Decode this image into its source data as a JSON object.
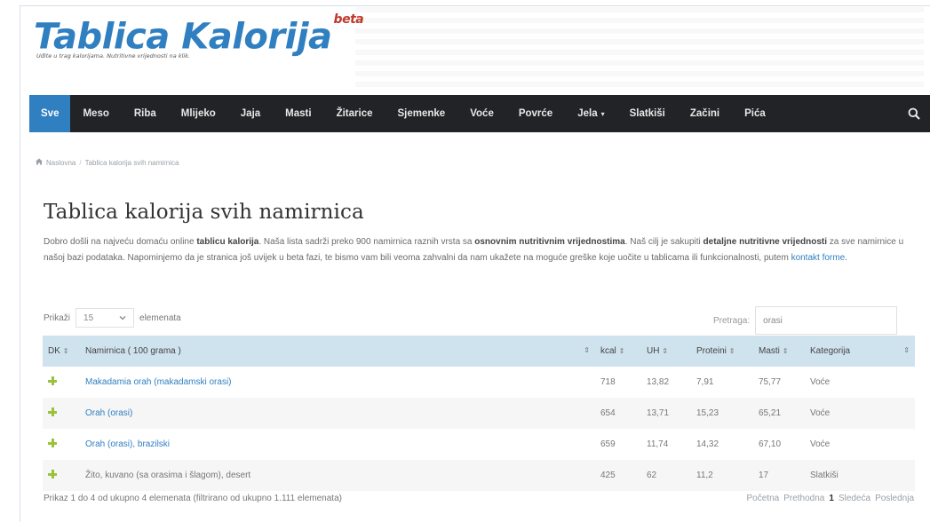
{
  "brand": {
    "logo": "Tablica Kalorija",
    "logo_sup": "beta",
    "tagline": "Uđite u trag kalorijama. Nutritivne vrijednosti na klik."
  },
  "nav": {
    "items": [
      {
        "label": "Sve",
        "active": true
      },
      {
        "label": "Meso"
      },
      {
        "label": "Riba"
      },
      {
        "label": "Mlijeko"
      },
      {
        "label": "Jaja"
      },
      {
        "label": "Masti"
      },
      {
        "label": "Žitarice"
      },
      {
        "label": "Sjemenke"
      },
      {
        "label": "Voće"
      },
      {
        "label": "Povrće"
      },
      {
        "label": "Jela",
        "caret": "▾"
      },
      {
        "label": "Slatkiši"
      },
      {
        "label": "Začini"
      },
      {
        "label": "Pića"
      }
    ],
    "search_icon": "search-icon",
    "active_color": "#2f7fc1",
    "bar_color": "#222326"
  },
  "breadcrumb": {
    "home_icon": "home-icon",
    "home": "Naslovna",
    "separator": "/",
    "current": "Tablica kalorija svih namirnica"
  },
  "page": {
    "title": "Tablica kalorija svih namirnica",
    "intro": {
      "p1": "Dobro došli na najveću domaću online ",
      "b1": "tablicu kalorija",
      "p2": ". Naša lista sadrži preko 900 namirnica raznih vrsta sa ",
      "b2": "osnovnim nutritivnim vrijednostima",
      "p3": ". Naš cilj je sakupiti ",
      "b3": "detaljne nutritivne vrijednosti",
      "p4": " za sve namirnice u našoj bazi podataka. Napominjemo da je stranica još uvijek u beta fazi, te bismo vam bili veoma zahvalni da nam ukažete na moguće greške koje uočite u tablicama ili funkcionalnosti, putem ",
      "link": "kontakt forme",
      "p5": "."
    }
  },
  "controls": {
    "show_label": "Prikaži",
    "page_size": "15",
    "dropdown_icon": "chevron-down-icon",
    "entries_label": "elemenata",
    "search_label": "Pretraga:",
    "search_value": "orasi"
  },
  "table": {
    "sort_icon": "⇕",
    "columns": [
      "DK",
      "Namirnica ( 100 grama )",
      "kcal",
      "UH",
      "Proteini",
      "Masti",
      "Kategorija"
    ],
    "rows": [
      {
        "name": "Makadamia orah (makadamski orasi)",
        "kcal": "718",
        "uh": "13,82",
        "proteini": "7,91",
        "masti": "75,77",
        "kategorija": "Voće",
        "linked": true
      },
      {
        "name": "Orah (orasi)",
        "kcal": "654",
        "uh": "13,71",
        "proteini": "15,23",
        "masti": "65,21",
        "kategorija": "Voće",
        "linked": true
      },
      {
        "name": "Orah (orasi), brazilski",
        "kcal": "659",
        "uh": "11,74",
        "proteini": "14,32",
        "masti": "67,10",
        "kategorija": "Voće",
        "linked": true
      },
      {
        "name": "Žito, kuvano (sa orasima i šlagom), desert",
        "kcal": "425",
        "uh": "62",
        "proteini": "11,2",
        "masti": "17",
        "kategorija": "Slatkiši",
        "linked": false
      }
    ],
    "plus_color": "#9ac23c",
    "header_color": "#cfe3ef"
  },
  "footer": {
    "info": "Prikaz 1 do 4 od ukupno 4 elemenata (filtrirano od ukupno 1.111 elemenata)",
    "pager": {
      "first": "Početna",
      "prev": "Prethodna",
      "current": "1",
      "next": "Sledeća",
      "last": "Poslednja"
    }
  }
}
